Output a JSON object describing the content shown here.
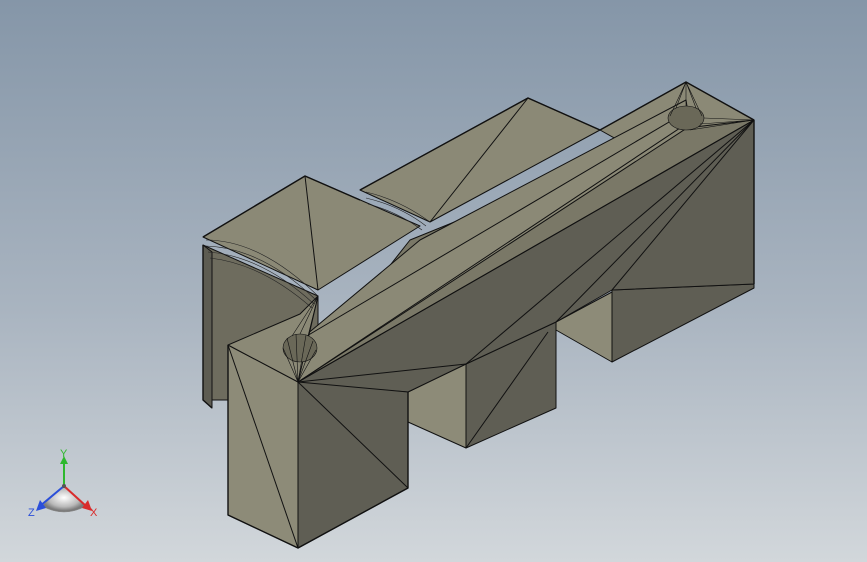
{
  "viewport": {
    "background_top": "#8596a8",
    "background_bottom": "#d2d7db"
  },
  "model": {
    "face_color_light": "#8d8b78",
    "face_color_mid": "#777565",
    "face_color_dark": "#5f5e54",
    "edge_color": "#111111"
  },
  "triad": {
    "x_label": "X",
    "y_label": "Y",
    "z_label": "Z",
    "x_color": "#d92b2b",
    "y_color": "#2eb82e",
    "z_color": "#2b4fd9"
  }
}
